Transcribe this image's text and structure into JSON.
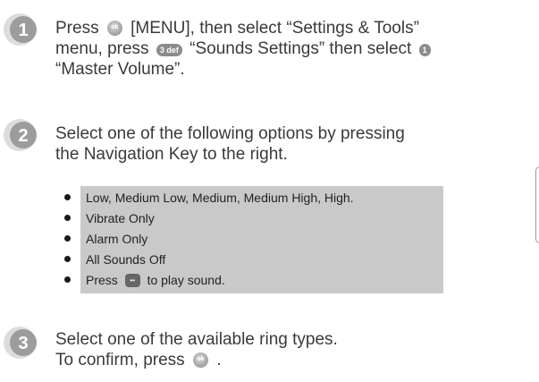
{
  "steps": [
    {
      "number": "1",
      "lines": [
        {
          "pre": "Press",
          "key": "ok",
          "post": "[MENU], then select “Settings & Tools”"
        },
        {
          "pre": "menu, press",
          "key": "3 def",
          "post": "“Sounds Settings” then select"
        },
        {
          "text": "“Master Volume”."
        }
      ],
      "trailing_key": "1"
    },
    {
      "number": "2",
      "lines": [
        {
          "text": "Select one of the following options by pressing"
        },
        {
          "text": "the Navigation Key to the right."
        }
      ]
    },
    {
      "number": "3",
      "lines": [
        {
          "text": "Select one of the available ring types."
        },
        {
          "pre": "To confirm, press",
          "key": "ok",
          "post": "."
        }
      ]
    }
  ],
  "options": [
    "Low, Medium Low, Medium, Medium High, High.",
    "Vibrate Only",
    "Alarm Only",
    "All Sounds Off"
  ],
  "play_option": {
    "pre": "Press",
    "post": "to play sound."
  },
  "colors": {
    "badge_bg": "#9c9c9c",
    "badge_ring": "#dcdcdc",
    "options_bg": "#c9c9c9",
    "text": "#3a3a3a"
  }
}
